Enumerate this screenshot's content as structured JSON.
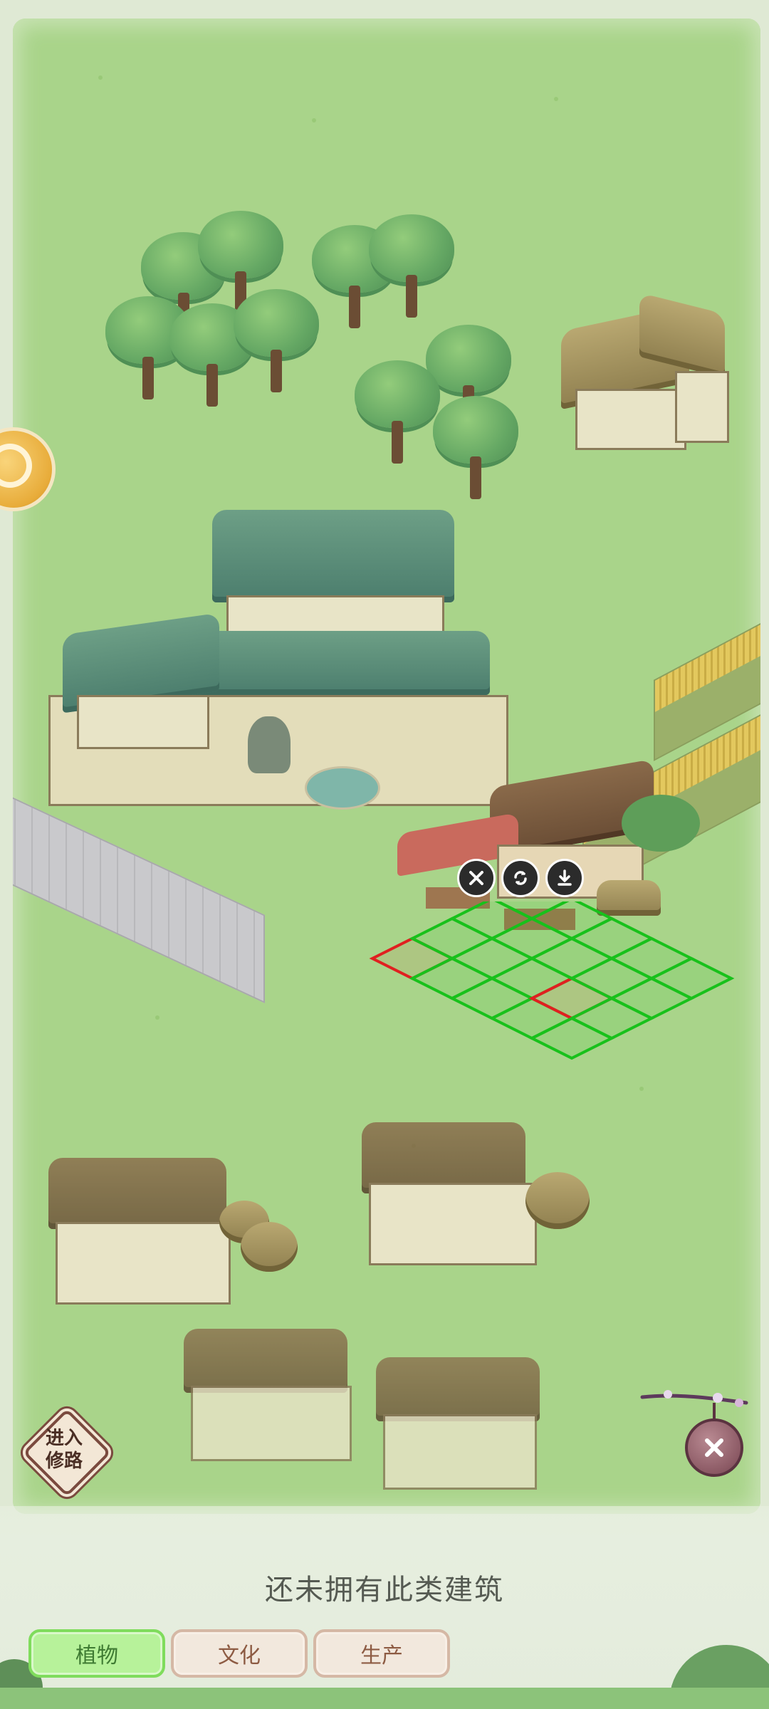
{
  "map": {
    "road_mode_label": "进入\n修路",
    "actions": [
      "cancel-placement",
      "rotate-building",
      "store-building"
    ]
  },
  "panel": {
    "empty_message": "还未拥有此类建筑"
  },
  "tabs": [
    {
      "label": "植物",
      "active": true
    },
    {
      "label": "文化",
      "active": false
    },
    {
      "label": "生产",
      "active": false
    }
  ],
  "colors": {
    "grass": "#a9d48a",
    "grid_valid": "#18c11b",
    "grid_invalid": "#e02020",
    "tab_active": "#b7f29a",
    "tab_inactive": "#f2e8dd"
  },
  "icons": {
    "cancel": "close-icon",
    "rotate": "rotate-icon",
    "store": "download-icon",
    "close": "close-icon"
  }
}
